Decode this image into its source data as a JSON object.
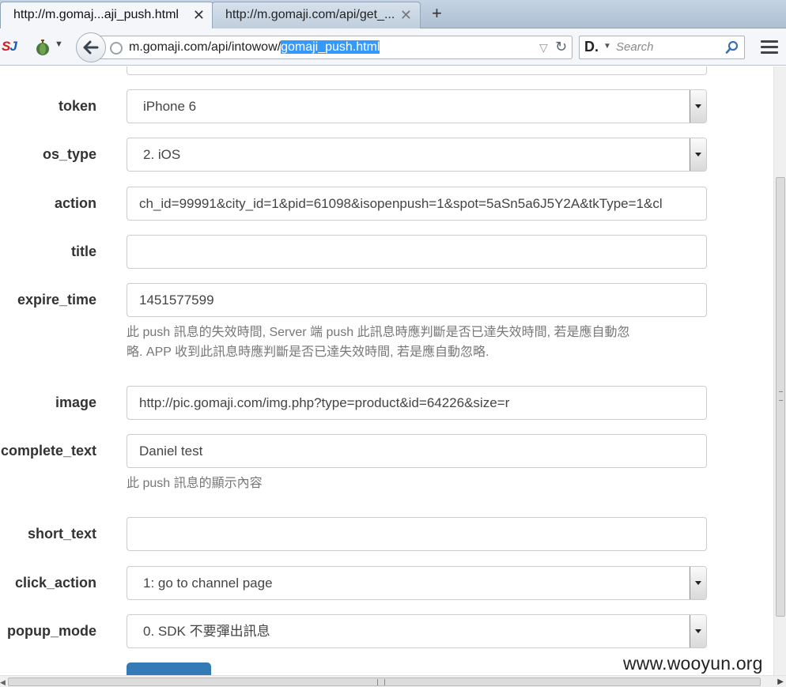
{
  "browser": {
    "tabs": [
      {
        "title": "http://m.gomaj...aji_push.html",
        "active": true
      },
      {
        "title": "http://m.gomaji.com/api/get_...",
        "active": false
      }
    ],
    "close_glyph": "✕",
    "new_tab_glyph": "+",
    "url_prefix": "m.gomaji.com/api/intowow/",
    "url_selected": "gomaji_push.html",
    "search_placeholder": "Search",
    "search_engine_glyph": "D.",
    "sj_logo": "S",
    "sj_logo_b": "J"
  },
  "form": {
    "token": {
      "label": "token",
      "value": "iPhone 6"
    },
    "os_type": {
      "label": "os_type",
      "value": "2. iOS"
    },
    "action": {
      "label": "action",
      "value": "ch_id=99991&city_id=1&pid=61098&isopenpush=1&spot=5aSn5a6J5Y2A&tkType=1&cl"
    },
    "title": {
      "label": "title",
      "value": ""
    },
    "expire_time": {
      "label": "expire_time",
      "value": "1451577599",
      "help_line1": "此 push 訊息的失效時間, Server 端 push 此訊息時應判斷是否已達失效時間, 若是應自動忽",
      "help_line2": "略. APP 收到此訊息時應判斷是否已達失效時間, 若是應自動忽略."
    },
    "image": {
      "label": "image",
      "value": "http://pic.gomaji.com/img.php?type=product&id=64226&size=r"
    },
    "complete_text": {
      "label": "complete_text",
      "value": "Daniel test",
      "help": "此 push 訊息的顯示內容"
    },
    "short_text": {
      "label": "short_text",
      "value": ""
    },
    "click_action": {
      "label": "click_action",
      "value": "1: go to channel page"
    },
    "popup_mode": {
      "label": "popup_mode",
      "value": "0. SDK 不要彈出訊息"
    }
  },
  "watermark": "www.wooyun.org",
  "colors": {
    "accent": "#337ab7",
    "selection": "#3399ff",
    "sj_red": "#cc1f1f",
    "sj_blue": "#1c5bb8"
  }
}
